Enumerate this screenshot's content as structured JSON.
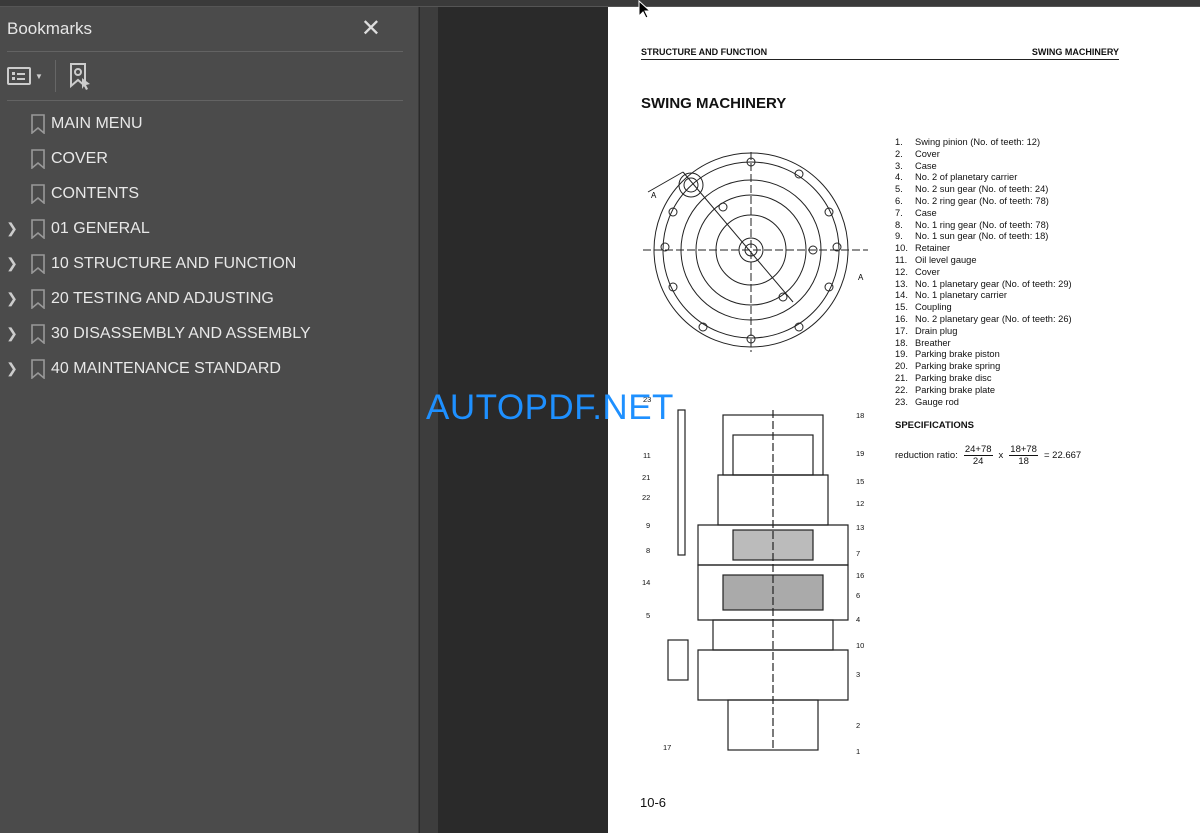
{
  "sidebar": {
    "title": "Bookmarks",
    "items": [
      {
        "label": "MAIN MENU",
        "expandable": false
      },
      {
        "label": "COVER",
        "expandable": false
      },
      {
        "label": "CONTENTS",
        "expandable": false
      },
      {
        "label": "01 GENERAL",
        "expandable": true
      },
      {
        "label": "10 STRUCTURE AND FUNCTION",
        "expandable": true
      },
      {
        "label": "20 TESTING AND ADJUSTING",
        "expandable": true
      },
      {
        "label": "30 DISASSEMBLY AND ASSEMBLY",
        "expandable": true
      },
      {
        "label": "40 MAINTENANCE STANDARD",
        "expandable": true
      }
    ]
  },
  "page": {
    "header_left": "STRUCTURE AND FUNCTION",
    "header_right": "SWING MACHINERY",
    "title": "SWING MACHINERY",
    "parts": [
      {
        "n": "1.",
        "t": "Swing pinion (No. of teeth: 12)"
      },
      {
        "n": "2.",
        "t": "Cover"
      },
      {
        "n": "3.",
        "t": "Case"
      },
      {
        "n": "4.",
        "t": "No. 2 of planetary carrier"
      },
      {
        "n": "5.",
        "t": "No. 2 sun gear (No. of teeth: 24)"
      },
      {
        "n": "6.",
        "t": "No. 2 ring gear (No. of teeth: 78)"
      },
      {
        "n": "7.",
        "t": "Case"
      },
      {
        "n": "8.",
        "t": "No. 1 ring gear (No. of teeth: 78)"
      },
      {
        "n": "9.",
        "t": "No. 1 sun gear (No. of teeth: 18)"
      },
      {
        "n": "10.",
        "t": "Retainer"
      },
      {
        "n": "11.",
        "t": "Oil level gauge"
      },
      {
        "n": "12.",
        "t": "Cover"
      },
      {
        "n": "13.",
        "t": "No. 1 planetary gear (No. of teeth: 29)"
      },
      {
        "n": "14.",
        "t": "No. 1 planetary carrier"
      },
      {
        "n": "15.",
        "t": "Coupling"
      },
      {
        "n": "16.",
        "t": "No. 2 planetary gear (No. of teeth: 26)"
      },
      {
        "n": "17.",
        "t": "Drain plug"
      },
      {
        "n": "18.",
        "t": "Breather"
      },
      {
        "n": "19.",
        "t": "Parking brake piston"
      },
      {
        "n": "20.",
        "t": "Parking brake spring"
      },
      {
        "n": "21.",
        "t": "Parking brake disc"
      },
      {
        "n": "22.",
        "t": "Parking brake plate"
      },
      {
        "n": "23.",
        "t": "Gauge rod"
      }
    ],
    "spec_title": "SPECIFICATIONS",
    "ratio_label": "reduction ratio:",
    "f1_num": "24+78",
    "f1_den": "24",
    "times": "x",
    "f2_num": "18+78",
    "f2_den": "18",
    "result": "= 22.667",
    "page_number": "10-6"
  },
  "watermark": "AUTOPDF.NET"
}
